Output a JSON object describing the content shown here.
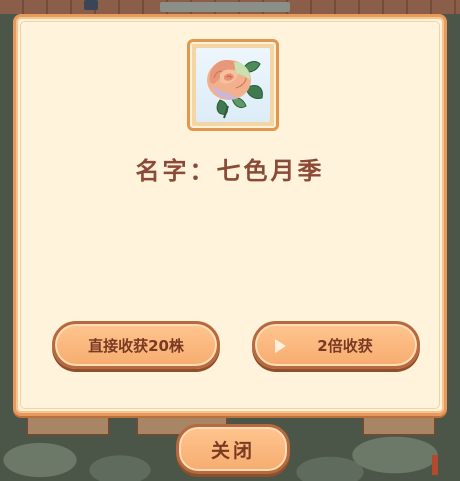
{
  "dialog": {
    "flower_image": "rose-flower-illustration",
    "name_label": "名字：",
    "name_value": "七色月季"
  },
  "buttons": {
    "harvest_direct": "直接收获20株",
    "harvest_double": "2倍收获",
    "close": "关闭"
  },
  "icons": {
    "play": "play-icon"
  },
  "colors": {
    "dialog_background": "#fff3dc",
    "dialog_border": "#e79a5b",
    "button_fill": "#f6ac6f",
    "button_border": "#b66a3f",
    "text_brown": "#8b4a36"
  }
}
